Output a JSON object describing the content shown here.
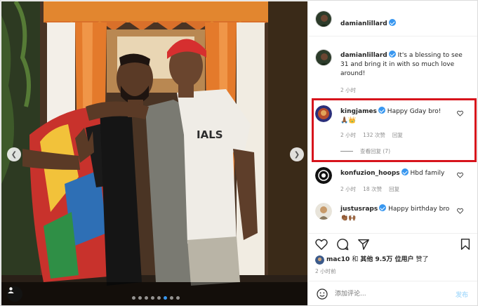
{
  "post": {
    "author": "damianlillard",
    "caption_author": "damianlillard",
    "caption": "It's a blessing to see 31 and bring it in with so much love around!",
    "caption_time": "2 小时"
  },
  "comments": [
    {
      "username": "kingjames",
      "text": "Happy Gday bro!",
      "emoji": "🙏🏾👑",
      "time": "2 小时",
      "likes": "132 次赞",
      "reply": "回复",
      "view_replies": "查看回复 (7)"
    },
    {
      "username": "konfuzion_hoops",
      "text": "Hbd family",
      "time": "2 小时",
      "likes": "18 次赞",
      "reply": "回复"
    },
    {
      "username": "justusraps",
      "text": "Happy birthday bro",
      "emoji": "👏🏾🙌🏾"
    }
  ],
  "likes_line": {
    "user": "mac10",
    "connector": "和",
    "others": "其他 9.5万 位用户",
    "suffix": "赞了"
  },
  "post_time": "2 小时前",
  "comment_input": {
    "placeholder": "添加评论...",
    "submit_label": "发布"
  },
  "carousel": {
    "total": 8,
    "current": 5
  },
  "colors": {
    "verified": "#3897f0",
    "highlight_border": "#d7141c",
    "meta_text": "#8e8e8e",
    "publish_disabled": "#b2dffc"
  },
  "icons": [
    "heart-icon",
    "comment-icon",
    "share-icon",
    "bookmark-icon",
    "emoji-icon",
    "tag-user-icon",
    "chevron-left-icon",
    "chevron-right-icon",
    "verified-badge-icon"
  ]
}
